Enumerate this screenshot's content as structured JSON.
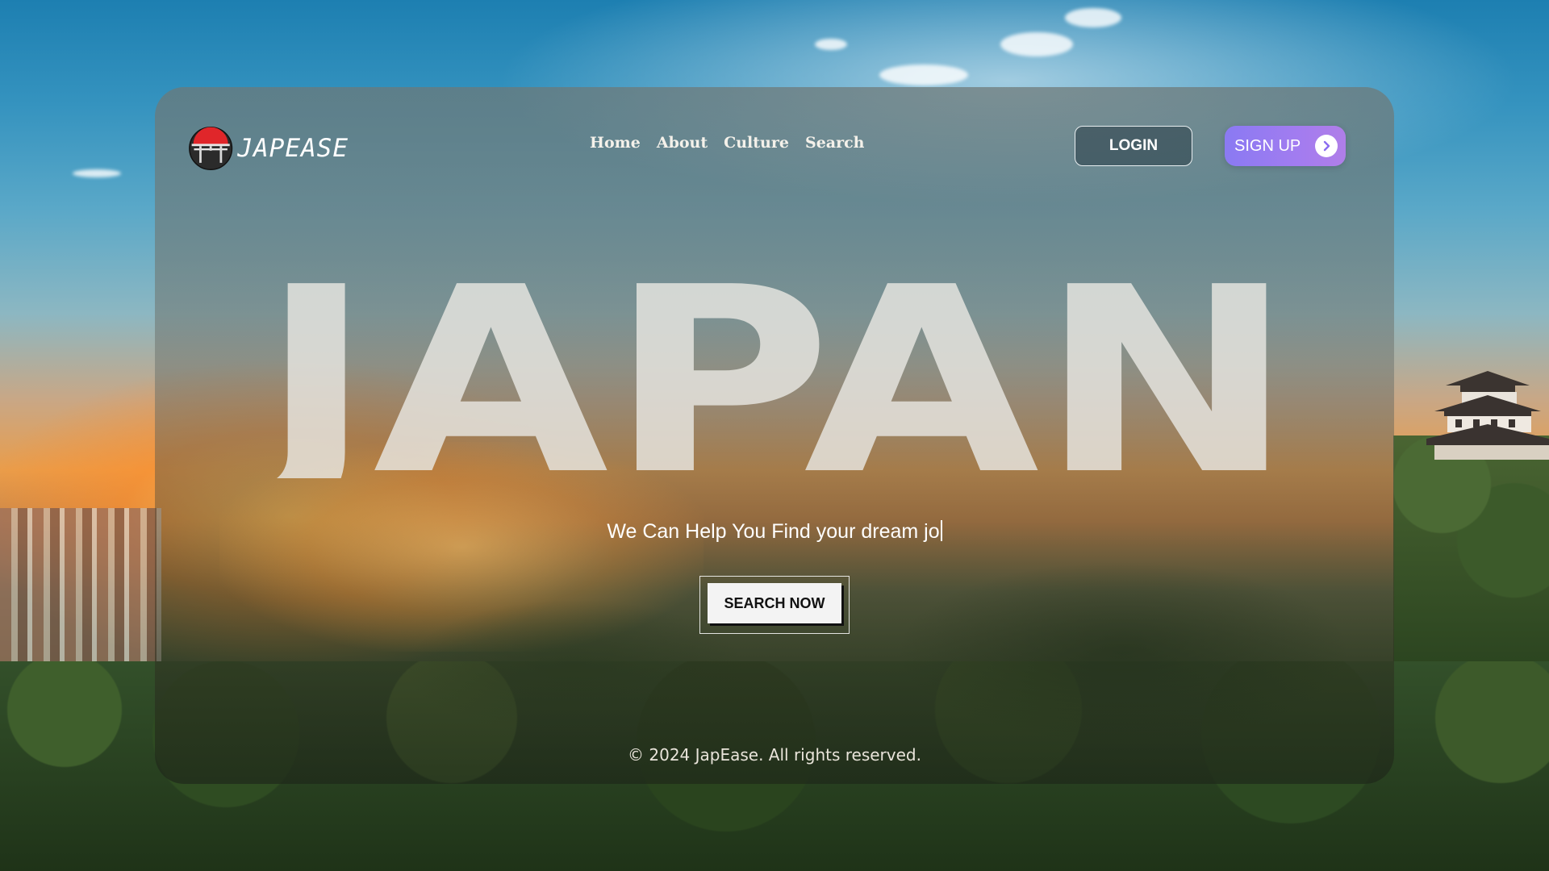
{
  "header": {
    "logo_text": "JAPEASE",
    "nav": [
      {
        "label": "Home"
      },
      {
        "label": "About"
      },
      {
        "label": "Culture"
      },
      {
        "label": "Search"
      }
    ],
    "login_label": "LOGIN",
    "signup_label": "SIGN UP"
  },
  "hero": {
    "title": "JAPAN",
    "tagline": "We Can Help You Find your dream jo",
    "search_button_label": "SEARCH NOW"
  },
  "footer": {
    "copyright": "© 2024 JapEase. All rights reserved."
  },
  "colors": {
    "signup_gradient_start": "#8a7af2",
    "signup_gradient_end": "#b07ee8",
    "hero_letter": "#e8e6e2",
    "logo_sun": "#e0262a"
  },
  "icons": {
    "logo": "torii-gate-sun-icon",
    "signup": "chevron-right-icon"
  }
}
